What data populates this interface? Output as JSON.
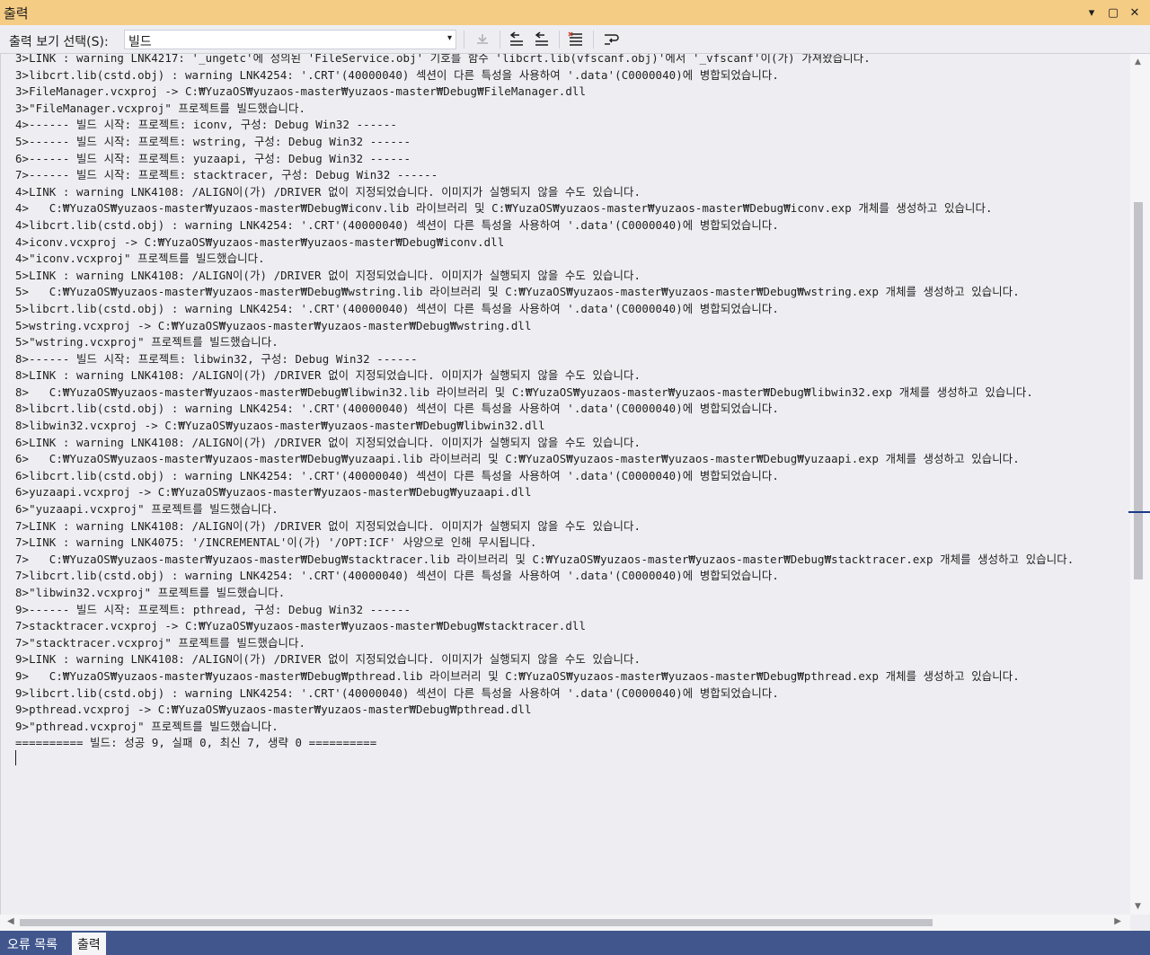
{
  "window": {
    "title": "출력",
    "dropdown_glyph": "▾",
    "restore_glyph": "▢",
    "close_glyph": "✕"
  },
  "toolbar": {
    "show_output_label": "출력 보기 선택(S):",
    "source_value": "빌드",
    "source_arrow": "▾"
  },
  "output": {
    "lines": [
      "3>LINK : warning LNK4217: '_ungetc'에 정의된 'FileService.obj' 기호를 함수 'libcrt.lib(vfscanf.obj)'에서 '_vfscanf'이(가) 가져왔습니다.",
      "3>libcrt.lib(cstd.obj) : warning LNK4254: '.CRT'(40000040) 섹션이 다른 특성을 사용하여 '.data'(C0000040)에 병합되었습니다.",
      "3>FileManager.vcxproj -> C:₩YuzaOS₩yuzaos-master₩yuzaos-master₩Debug₩FileManager.dll",
      "3>\"FileManager.vcxproj\" 프로젝트를 빌드했습니다.",
      "4>------ 빌드 시작: 프로젝트: iconv, 구성: Debug Win32 ------",
      "5>------ 빌드 시작: 프로젝트: wstring, 구성: Debug Win32 ------",
      "6>------ 빌드 시작: 프로젝트: yuzaapi, 구성: Debug Win32 ------",
      "7>------ 빌드 시작: 프로젝트: stacktracer, 구성: Debug Win32 ------",
      "4>LINK : warning LNK4108: /ALIGN이(가) /DRIVER 없이 지정되었습니다. 이미지가 실행되지 않을 수도 있습니다.",
      "4>   C:₩YuzaOS₩yuzaos-master₩yuzaos-master₩Debug₩iconv.lib 라이브러리 및 C:₩YuzaOS₩yuzaos-master₩yuzaos-master₩Debug₩iconv.exp 개체를 생성하고 있습니다.",
      "4>libcrt.lib(cstd.obj) : warning LNK4254: '.CRT'(40000040) 섹션이 다른 특성을 사용하여 '.data'(C0000040)에 병합되었습니다.",
      "4>iconv.vcxproj -> C:₩YuzaOS₩yuzaos-master₩yuzaos-master₩Debug₩iconv.dll",
      "4>\"iconv.vcxproj\" 프로젝트를 빌드했습니다.",
      "5>LINK : warning LNK4108: /ALIGN이(가) /DRIVER 없이 지정되었습니다. 이미지가 실행되지 않을 수도 있습니다.",
      "5>   C:₩YuzaOS₩yuzaos-master₩yuzaos-master₩Debug₩wstring.lib 라이브러리 및 C:₩YuzaOS₩yuzaos-master₩yuzaos-master₩Debug₩wstring.exp 개체를 생성하고 있습니다.",
      "5>libcrt.lib(cstd.obj) : warning LNK4254: '.CRT'(40000040) 섹션이 다른 특성을 사용하여 '.data'(C0000040)에 병합되었습니다.",
      "5>wstring.vcxproj -> C:₩YuzaOS₩yuzaos-master₩yuzaos-master₩Debug₩wstring.dll",
      "5>\"wstring.vcxproj\" 프로젝트를 빌드했습니다.",
      "8>------ 빌드 시작: 프로젝트: libwin32, 구성: Debug Win32 ------",
      "8>LINK : warning LNK4108: /ALIGN이(가) /DRIVER 없이 지정되었습니다. 이미지가 실행되지 않을 수도 있습니다.",
      "8>   C:₩YuzaOS₩yuzaos-master₩yuzaos-master₩Debug₩libwin32.lib 라이브러리 및 C:₩YuzaOS₩yuzaos-master₩yuzaos-master₩Debug₩libwin32.exp 개체를 생성하고 있습니다.",
      "8>libcrt.lib(cstd.obj) : warning LNK4254: '.CRT'(40000040) 섹션이 다른 특성을 사용하여 '.data'(C0000040)에 병합되었습니다.",
      "8>libwin32.vcxproj -> C:₩YuzaOS₩yuzaos-master₩yuzaos-master₩Debug₩libwin32.dll",
      "6>LINK : warning LNK4108: /ALIGN이(가) /DRIVER 없이 지정되었습니다. 이미지가 실행되지 않을 수도 있습니다.",
      "6>   C:₩YuzaOS₩yuzaos-master₩yuzaos-master₩Debug₩yuzaapi.lib 라이브러리 및 C:₩YuzaOS₩yuzaos-master₩yuzaos-master₩Debug₩yuzaapi.exp 개체를 생성하고 있습니다.",
      "6>libcrt.lib(cstd.obj) : warning LNK4254: '.CRT'(40000040) 섹션이 다른 특성을 사용하여 '.data'(C0000040)에 병합되었습니다.",
      "6>yuzaapi.vcxproj -> C:₩YuzaOS₩yuzaos-master₩yuzaos-master₩Debug₩yuzaapi.dll",
      "6>\"yuzaapi.vcxproj\" 프로젝트를 빌드했습니다.",
      "7>LINK : warning LNK4108: /ALIGN이(가) /DRIVER 없이 지정되었습니다. 이미지가 실행되지 않을 수도 있습니다.",
      "7>LINK : warning LNK4075: '/INCREMENTAL'이(가) '/OPT:ICF' 사양으로 인해 무시됩니다.",
      "7>   C:₩YuzaOS₩yuzaos-master₩yuzaos-master₩Debug₩stacktracer.lib 라이브러리 및 C:₩YuzaOS₩yuzaos-master₩yuzaos-master₩Debug₩stacktracer.exp 개체를 생성하고 있습니다.",
      "7>libcrt.lib(cstd.obj) : warning LNK4254: '.CRT'(40000040) 섹션이 다른 특성을 사용하여 '.data'(C0000040)에 병합되었습니다.",
      "8>\"libwin32.vcxproj\" 프로젝트를 빌드했습니다.",
      "9>------ 빌드 시작: 프로젝트: pthread, 구성: Debug Win32 ------",
      "7>stacktracer.vcxproj -> C:₩YuzaOS₩yuzaos-master₩yuzaos-master₩Debug₩stacktracer.dll",
      "7>\"stacktracer.vcxproj\" 프로젝트를 빌드했습니다.",
      "9>LINK : warning LNK4108: /ALIGN이(가) /DRIVER 없이 지정되었습니다. 이미지가 실행되지 않을 수도 있습니다.",
      "9>   C:₩YuzaOS₩yuzaos-master₩yuzaos-master₩Debug₩pthread.lib 라이브러리 및 C:₩YuzaOS₩yuzaos-master₩yuzaos-master₩Debug₩pthread.exp 개체를 생성하고 있습니다.",
      "9>libcrt.lib(cstd.obj) : warning LNK4254: '.CRT'(40000040) 섹션이 다른 특성을 사용하여 '.data'(C0000040)에 병합되었습니다.",
      "9>pthread.vcxproj -> C:₩YuzaOS₩yuzaos-master₩yuzaos-master₩Debug₩pthread.dll",
      "9>\"pthread.vcxproj\" 프로젝트를 빌드했습니다.",
      "========== 빌드: 성공 9, 실패 0, 최신 7, 생략 0 =========="
    ]
  },
  "scrollbars": {
    "up_glyph": "▲",
    "down_glyph": "▼",
    "left_glyph": "◀",
    "right_glyph": "▶"
  },
  "tabs": [
    {
      "label": "오류 목록"
    },
    {
      "label": "출력"
    }
  ]
}
